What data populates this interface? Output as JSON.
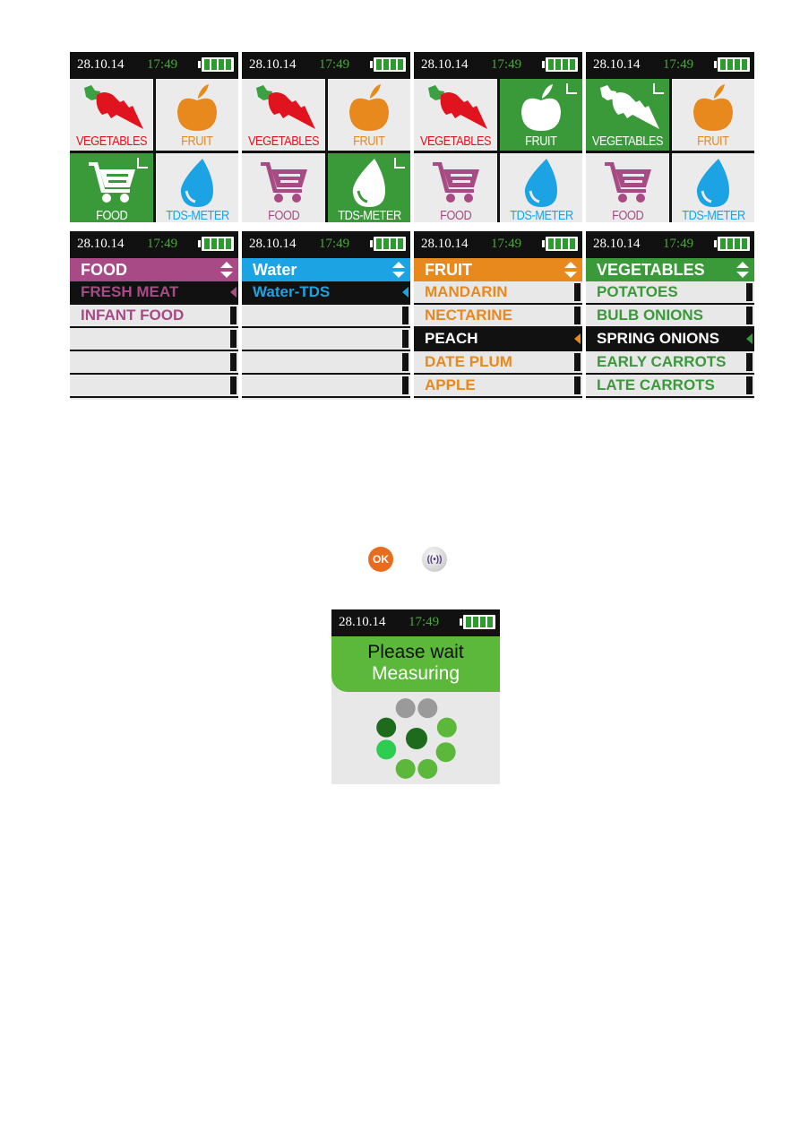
{
  "status": {
    "date": "28.10.14",
    "time": "17:49"
  },
  "menu_screens": [
    {
      "selected": "FOOD"
    },
    {
      "selected": "TDS-METER"
    },
    {
      "selected": "FRUIT"
    },
    {
      "selected": "VEGETABLES"
    }
  ],
  "tiles": {
    "vegetables": "VEGETABLES",
    "fruit": "FRUIT",
    "food": "FOOD",
    "tds": "TDS-METER"
  },
  "lists": [
    {
      "title": "FOOD",
      "color": "#a84a86",
      "items": [
        "FRESH MEAT",
        "INFANT FOOD",
        "",
        "",
        ""
      ],
      "selected": 0
    },
    {
      "title": "Water",
      "color": "#1ba3e3",
      "items": [
        "Water-TDS",
        "",
        "",
        "",
        ""
      ],
      "selected": 0
    },
    {
      "title": "FRUIT",
      "color": "#e8891e",
      "items": [
        "MANDARIN",
        "NECTARINE",
        "PEACH",
        "DATE PLUM",
        "APPLE"
      ],
      "selected": 2
    },
    {
      "title": "VEGETABLES",
      "color": "#3a9a3a",
      "items": [
        "POTATOES",
        "BULB ONIONS",
        "SPRING ONIONS",
        "EARLY CARROTS",
        "LATE CARROTS"
      ],
      "selected": 2
    }
  ],
  "buttons": {
    "ok": "OK",
    "sensor": "((•))"
  },
  "measuring": {
    "line1": "Please wait",
    "line2": "Measuring"
  },
  "colors": {
    "green": "#3a9a3a",
    "red": "#e0141e",
    "orange": "#e8891e",
    "purple": "#a84a86",
    "blue": "#1ba3e3"
  }
}
